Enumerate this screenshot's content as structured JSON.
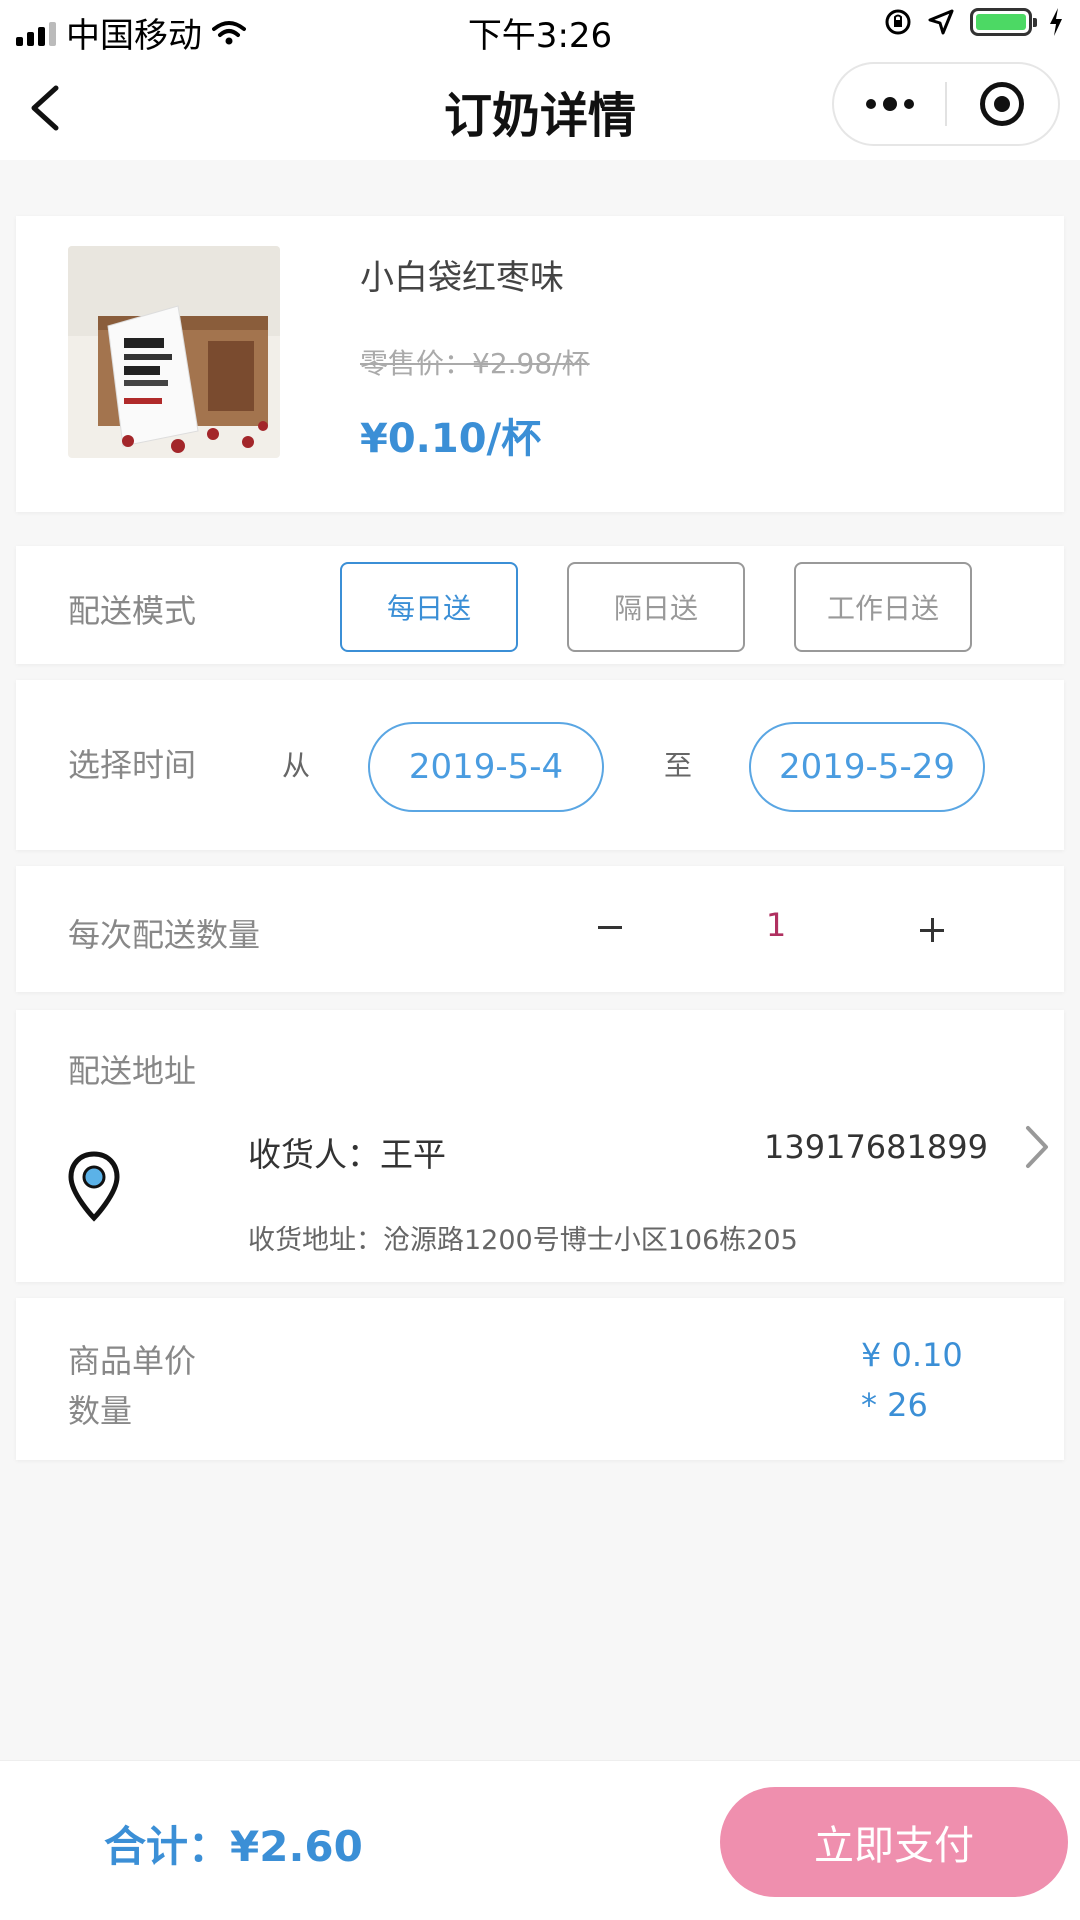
{
  "status_bar": {
    "carrier": "中国移动",
    "time": "下午3:26"
  },
  "nav": {
    "title": "订奶详情"
  },
  "product": {
    "name": "小白袋红枣味",
    "retail_price": "零售价：¥2.98/杯",
    "price": "¥0.10/杯"
  },
  "delivery_mode": {
    "label": "配送模式",
    "options": [
      "每日送",
      "隔日送",
      "工作日送"
    ],
    "selected": "每日送"
  },
  "time_select": {
    "label": "选择时间",
    "from_label": "从",
    "from_date": "2019-5-4",
    "to_label": "至",
    "to_date": "2019-5-29"
  },
  "quantity": {
    "label": "每次配送数量",
    "value": "1"
  },
  "address": {
    "label": "配送地址",
    "receiver": "收货人：王平",
    "phone": "13917681899",
    "detail": "收货地址：沧源路1200号博士小区106栋205"
  },
  "summary": {
    "unit_price_label": "商品单价",
    "quantity_label": "数量",
    "unit_price_value": "¥ 0.10",
    "quantity_value": "* 26"
  },
  "bottom": {
    "total": "合计：¥2.60",
    "pay_button": "立即支付"
  },
  "colors": {
    "accent": "#3b8fd6",
    "pay_button": "#ef8fae",
    "quantity_value": "#b03060"
  }
}
